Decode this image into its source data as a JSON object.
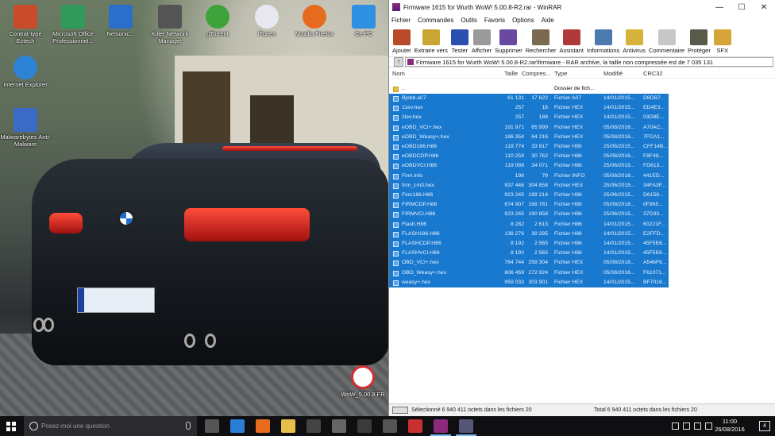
{
  "desktop": {
    "icons": [
      {
        "label": "Contrat-type Ectech",
        "color": "#c94c2a"
      },
      {
        "label": "Microsoft Office Professionnel...",
        "color": "#2f9a5a"
      },
      {
        "label": "Nelsonic...",
        "color": "#2a6fc9"
      },
      {
        "label": "Killer Network Manager",
        "color": "#555555"
      },
      {
        "label": "µTorrent",
        "color": "#3ea33a"
      },
      {
        "label": "iTunes",
        "color": "#e8e8f0"
      },
      {
        "label": "Mozilla Firefox",
        "color": "#e66b1e"
      },
      {
        "label": "Ce PC",
        "color": "#2f8fe0"
      },
      {
        "label": "Internet Explorer",
        "color": "#2d84d6"
      },
      {
        "label": "Malwarebytes Anti-Malware",
        "color": "#3b6bc7"
      },
      {
        "label": "WoW_5.00.8.FR",
        "color": "#d23030"
      }
    ]
  },
  "winrar": {
    "title": "Firmware 1615 for Wurth WoW! 5.00.8-R2.rar - WinRAR",
    "caption": {
      "minimize": "—",
      "maximize": "☐",
      "close": "✕"
    },
    "menu": [
      "Fichier",
      "Commandes",
      "Outils",
      "Favoris",
      "Options",
      "Aide"
    ],
    "toolbar": [
      {
        "label": "Ajouter",
        "icon": "add-icon",
        "color": "#b84a2a"
      },
      {
        "label": "Extraire vers",
        "icon": "extract-icon",
        "color": "#c9a533"
      },
      {
        "label": "Tester",
        "icon": "test-icon",
        "color": "#2a4fb0"
      },
      {
        "label": "Afficher",
        "icon": "view-icon",
        "color": "#9a9a9a"
      },
      {
        "label": "Supprimer",
        "icon": "delete-icon",
        "color": "#6a4aa0"
      },
      {
        "label": "Rechercher",
        "icon": "find-icon",
        "color": "#7a6a50"
      },
      {
        "label": "Assistant",
        "icon": "wizard-icon",
        "color": "#b03a3a"
      },
      {
        "label": "Informations",
        "icon": "info-icon",
        "color": "#4a7ab0"
      },
      {
        "label": "Antivirus",
        "icon": "antivirus-icon",
        "color": "#d6b23a"
      },
      {
        "label": "Commentaire",
        "icon": "comment-icon",
        "color": "#c7c7c7"
      },
      {
        "label": "Protéger",
        "icon": "protect-icon",
        "color": "#5a5a4a"
      },
      {
        "label": "SFX",
        "icon": "sfx-icon",
        "color": "#d6a53a"
      }
    ],
    "address": "Firmware 1615 for Wurth WoW! 5.00.8-R2.rar\\firmware - RAR archive, la taille non compressée est de 7 035 131",
    "columns": {
      "name": "Nom",
      "size": "Taille",
      "packed": "Compres...",
      "type": "Type",
      "modified": "Modifié",
      "crc": "CRC32"
    },
    "parent_row": {
      "name": "..",
      "type": "Dossier de fich..."
    },
    "files": [
      {
        "name": "Bjobb.a07",
        "size": "61 131",
        "packed": "17 622",
        "type": "Fichier A07",
        "modified": "14/01/2015...",
        "crc": "D8DB7..."
      },
      {
        "name": "11ev.hex",
        "size": "257",
        "packed": "16",
        "type": "Fichier HEX",
        "modified": "14/01/2015...",
        "crc": "ED4E3..."
      },
      {
        "name": "2lev.hex",
        "size": "257",
        "packed": "188",
        "type": "Fichier HEX",
        "modified": "14/01/2015...",
        "crc": "03D8E..."
      },
      {
        "name": "eOBD_VCI+.hex",
        "size": "191 971",
        "packed": "65 999",
        "type": "Fichier HEX",
        "modified": "05/08/2016...",
        "crc": "A70AC..."
      },
      {
        "name": "eOBD_Weasy+.hex",
        "size": "186 354",
        "packed": "64 216",
        "type": "Fichier HEX",
        "modified": "05/08/2016...",
        "crc": "7FDA1..."
      },
      {
        "name": "eOBD186.H86",
        "size": "118 774",
        "packed": "33 917",
        "type": "Fichier H86",
        "modified": "25/06/2015...",
        "crc": "CFF14B..."
      },
      {
        "name": "eOBDCDP.H86",
        "size": "110 259",
        "packed": "30 762",
        "type": "Fichier H86",
        "modified": "05/08/2016...",
        "crc": "F8F48..."
      },
      {
        "name": "eOBDVCI.H86",
        "size": "119 089",
        "packed": "34 071",
        "type": "Fichier H86",
        "modified": "25/06/2015...",
        "crc": "FD613..."
      },
      {
        "name": "Firm.info",
        "size": "198",
        "packed": "79",
        "type": "Fichier INFO",
        "modified": "05/08/2016...",
        "crc": "441ED..."
      },
      {
        "name": "firm_cm3.hex",
        "size": "937 446",
        "packed": "304 858",
        "type": "Fichier HEX",
        "modified": "25/06/2015...",
        "crc": "34FA3F..."
      },
      {
        "name": "Firm186.H86",
        "size": "923 245",
        "packed": "199 214",
        "type": "Fichier H86",
        "modified": "25/06/2015...",
        "crc": "D6158..."
      },
      {
        "name": "FIRMCDP.H86",
        "size": "674 907",
        "packed": "168 781",
        "type": "Fichier H86",
        "modified": "05/08/2016...",
        "crc": "0F865..."
      },
      {
        "name": "FIRMVCI.H86",
        "size": "923 245",
        "packed": "190 858",
        "type": "Fichier H86",
        "modified": "25/06/2015...",
        "crc": "37D33..."
      },
      {
        "name": "Flash.H86",
        "size": "8 282",
        "packed": "2 613",
        "type": "Fichier H86",
        "modified": "14/01/2015...",
        "crc": "60221F..."
      },
      {
        "name": "FLASH186.H86",
        "size": "138 276",
        "packed": "39 285",
        "type": "Fichier H86",
        "modified": "14/01/2015...",
        "crc": "E2FFD..."
      },
      {
        "name": "FLASHCDP.H86",
        "size": "8 192",
        "packed": "2 565",
        "type": "Fichier H86",
        "modified": "14/01/2015...",
        "crc": "45F5E6..."
      },
      {
        "name": "FLASHVCI.H86",
        "size": "8 192",
        "packed": "2 565",
        "type": "Fichier H86",
        "modified": "14/01/2015...",
        "crc": "45F5E6..."
      },
      {
        "name": "OBD_VCI+.hex",
        "size": "764 744",
        "packed": "258 304",
        "type": "Fichier HEX",
        "modified": "05/08/2016...",
        "crc": "A546F6..."
      },
      {
        "name": "OBD_Weasy+.hex",
        "size": "806 459",
        "packed": "272 924",
        "type": "Fichier HEX",
        "modified": "05/08/2016...",
        "crc": "F61071..."
      },
      {
        "name": "weasy+.hex",
        "size": "959 033",
        "packed": "303 901",
        "type": "Fichier HEX",
        "modified": "14/01/2015...",
        "crc": "BF7018..."
      }
    ],
    "status": {
      "selected": "Sélectionné 6 940 411 octets dans les fichiers 20",
      "total": "Total 6 940 411 octets dans les fichiers 20"
    }
  },
  "taskbar": {
    "search_placeholder": "Posez-moi une question",
    "apps": [
      {
        "icon": "task-view-icon",
        "color": "#555555"
      },
      {
        "icon": "edge-icon",
        "color": "#2a7fd4"
      },
      {
        "icon": "firefox-icon",
        "color": "#e66b1e"
      },
      {
        "icon": "file-explorer-icon",
        "color": "#e6c04a"
      },
      {
        "icon": "store-icon",
        "color": "#444444"
      },
      {
        "icon": "killer-icon",
        "color": "#666666"
      },
      {
        "icon": "calculator-icon",
        "color": "#3a3a3a"
      },
      {
        "icon": "app-icon",
        "color": "#555555"
      },
      {
        "icon": "wow-icon",
        "color": "#c93030"
      },
      {
        "icon": "winrar-icon",
        "color": "#8b2a7a"
      },
      {
        "icon": "monitor-icon",
        "color": "#555577"
      }
    ],
    "time": "11:00",
    "date": "26/08/2016",
    "notification_count": "4"
  }
}
